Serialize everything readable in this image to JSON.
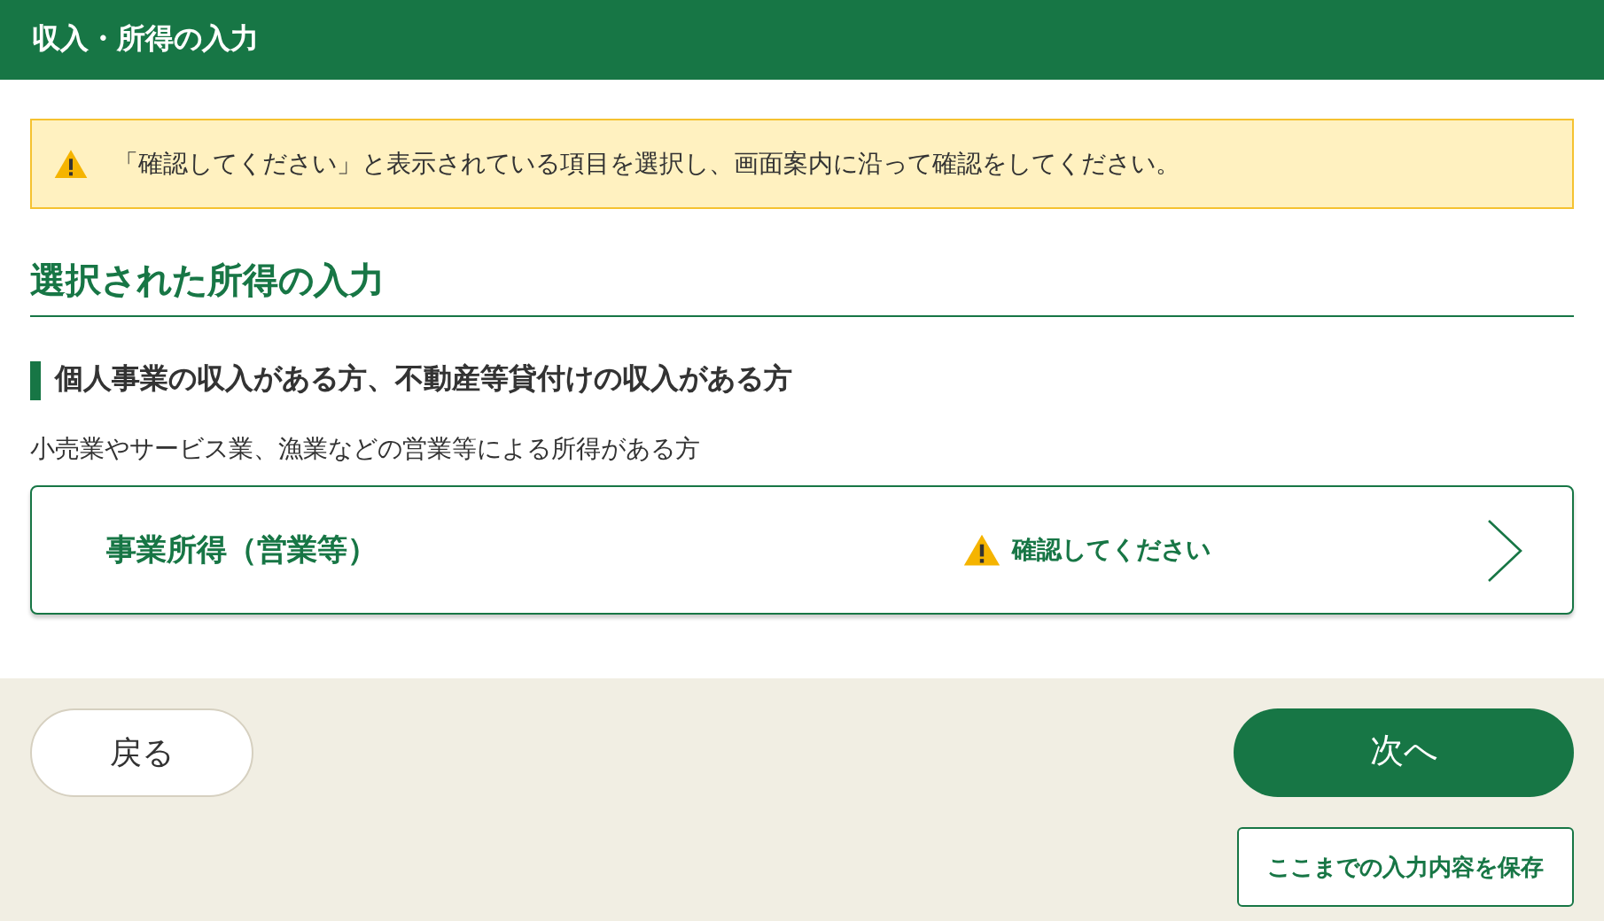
{
  "header": {
    "title": "収入・所得の入力"
  },
  "alert": {
    "text": "「確認してください」と表示されている項目を選択し、画面案内に沿って確認をしてください。"
  },
  "section": {
    "title": "選択された所得の入力"
  },
  "group": {
    "title": "個人事業の収入がある方、不動産等貸付けの収入がある方",
    "description": "小売業やサービス業、漁業などの営業等による所得がある方"
  },
  "items": [
    {
      "label": "事業所得（営業等）",
      "status": "確認してください",
      "needs_check": true
    }
  ],
  "footer": {
    "back": "戻る",
    "next": "次へ",
    "save": "ここまでの入力内容を保存"
  }
}
